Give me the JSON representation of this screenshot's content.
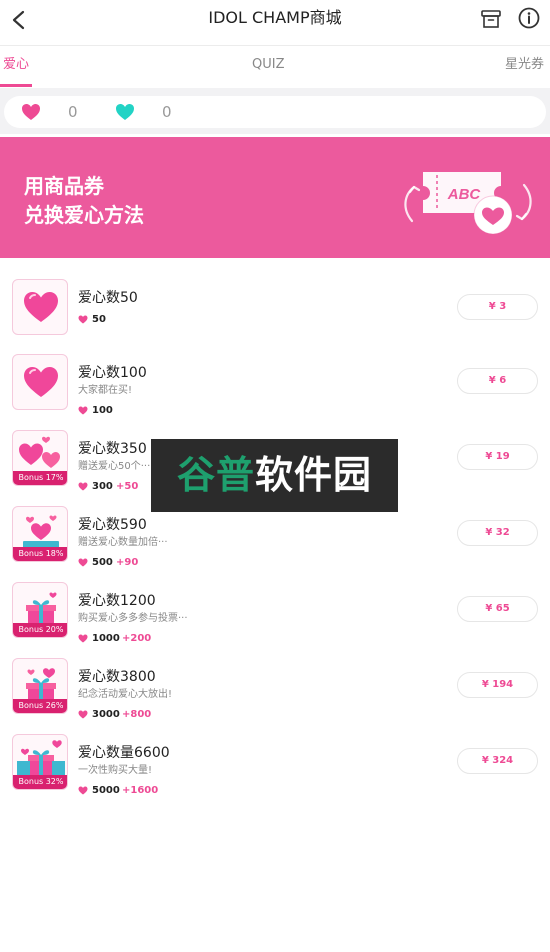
{
  "header": {
    "title": "IDOL CHAMP商城"
  },
  "tabs": [
    {
      "label": "爱心",
      "active": true
    },
    {
      "label": "QUIZ",
      "active": false
    },
    {
      "label": "星光券",
      "active": false
    }
  ],
  "balances": {
    "pink_hearts": "0",
    "teal_hearts": "0"
  },
  "banner": {
    "line1": "用商品券",
    "line2": "兑换爱心方法",
    "ticket_text": "ABC"
  },
  "products": [
    {
      "name": "爱心数50",
      "desc": "",
      "amount": "50",
      "bonus": "",
      "bonus_tag": "",
      "price": "¥ 3"
    },
    {
      "name": "爱心数100",
      "desc": "大家都在买!",
      "amount": "100",
      "bonus": "",
      "bonus_tag": "",
      "price": "¥ 6"
    },
    {
      "name": "爱心数350",
      "desc": "赠送爱心50个···",
      "amount": "300",
      "bonus": "+50",
      "bonus_tag": "Bonus 17%",
      "price": "¥ 19"
    },
    {
      "name": "爱心数590",
      "desc": "赠送爱心数量加倍···",
      "amount": "500",
      "bonus": "+90",
      "bonus_tag": "Bonus 18%",
      "price": "¥ 32"
    },
    {
      "name": "爱心数1200",
      "desc": "购买爱心多多参与投票···",
      "amount": "1000",
      "bonus": "+200",
      "bonus_tag": "Bonus 20%",
      "price": "¥ 65"
    },
    {
      "name": "爱心数3800",
      "desc": "纪念活动爱心大放出!",
      "amount": "3000",
      "bonus": "+800",
      "bonus_tag": "Bonus 26%",
      "price": "¥ 194"
    },
    {
      "name": "爱心数量6600",
      "desc": "一次性购买大量!",
      "amount": "5000",
      "bonus": "+1600",
      "bonus_tag": "Bonus 32%",
      "price": "¥ 324"
    }
  ],
  "watermark": {
    "part1": "谷普",
    "part2": "软件园"
  },
  "colors": {
    "accent": "#ee4a94",
    "banner": "#ec5a9d",
    "teal": "#22d3c5",
    "bonus_tag": "#d9216f"
  }
}
